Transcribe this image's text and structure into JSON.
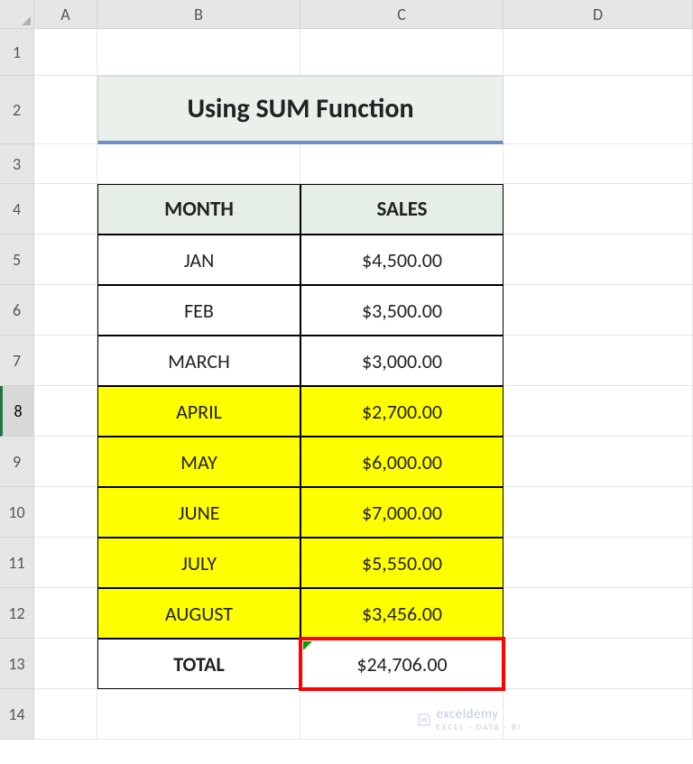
{
  "columns": [
    "A",
    "B",
    "C",
    "D"
  ],
  "rows": [
    "1",
    "2",
    "3",
    "4",
    "5",
    "6",
    "7",
    "8",
    "9",
    "10",
    "11",
    "12",
    "13",
    "14"
  ],
  "title": "Using SUM Function",
  "headers": {
    "month": "MONTH",
    "sales": "SALES"
  },
  "data": [
    {
      "month": "JAN",
      "sales": "$4,500.00",
      "highlight": false
    },
    {
      "month": "FEB",
      "sales": "$3,500.00",
      "highlight": false
    },
    {
      "month": "MARCH",
      "sales": "$3,000.00",
      "highlight": false
    },
    {
      "month": "APRIL",
      "sales": "$2,700.00",
      "highlight": true
    },
    {
      "month": "MAY",
      "sales": "$6,000.00",
      "highlight": true
    },
    {
      "month": "JUNE",
      "sales": "$7,000.00",
      "highlight": true
    },
    {
      "month": "JULY",
      "sales": "$5,550.00",
      "highlight": true
    },
    {
      "month": "AUGUST",
      "sales": "$3,456.00",
      "highlight": true
    }
  ],
  "total": {
    "label": "TOTAL",
    "value": "$24,706.00"
  },
  "selected_row": "8",
  "watermark": {
    "name": "exceldemy",
    "tag": "EXCEL · DATA · BI"
  },
  "chart_data": {
    "type": "table",
    "title": "Using SUM Function",
    "columns": [
      "MONTH",
      "SALES"
    ],
    "rows": [
      [
        "JAN",
        4500.0
      ],
      [
        "FEB",
        3500.0
      ],
      [
        "MARCH",
        3000.0
      ],
      [
        "APRIL",
        2700.0
      ],
      [
        "MAY",
        6000.0
      ],
      [
        "JUNE",
        7000.0
      ],
      [
        "JULY",
        5550.0
      ],
      [
        "AUGUST",
        3456.0
      ]
    ],
    "total": 24706.0
  }
}
